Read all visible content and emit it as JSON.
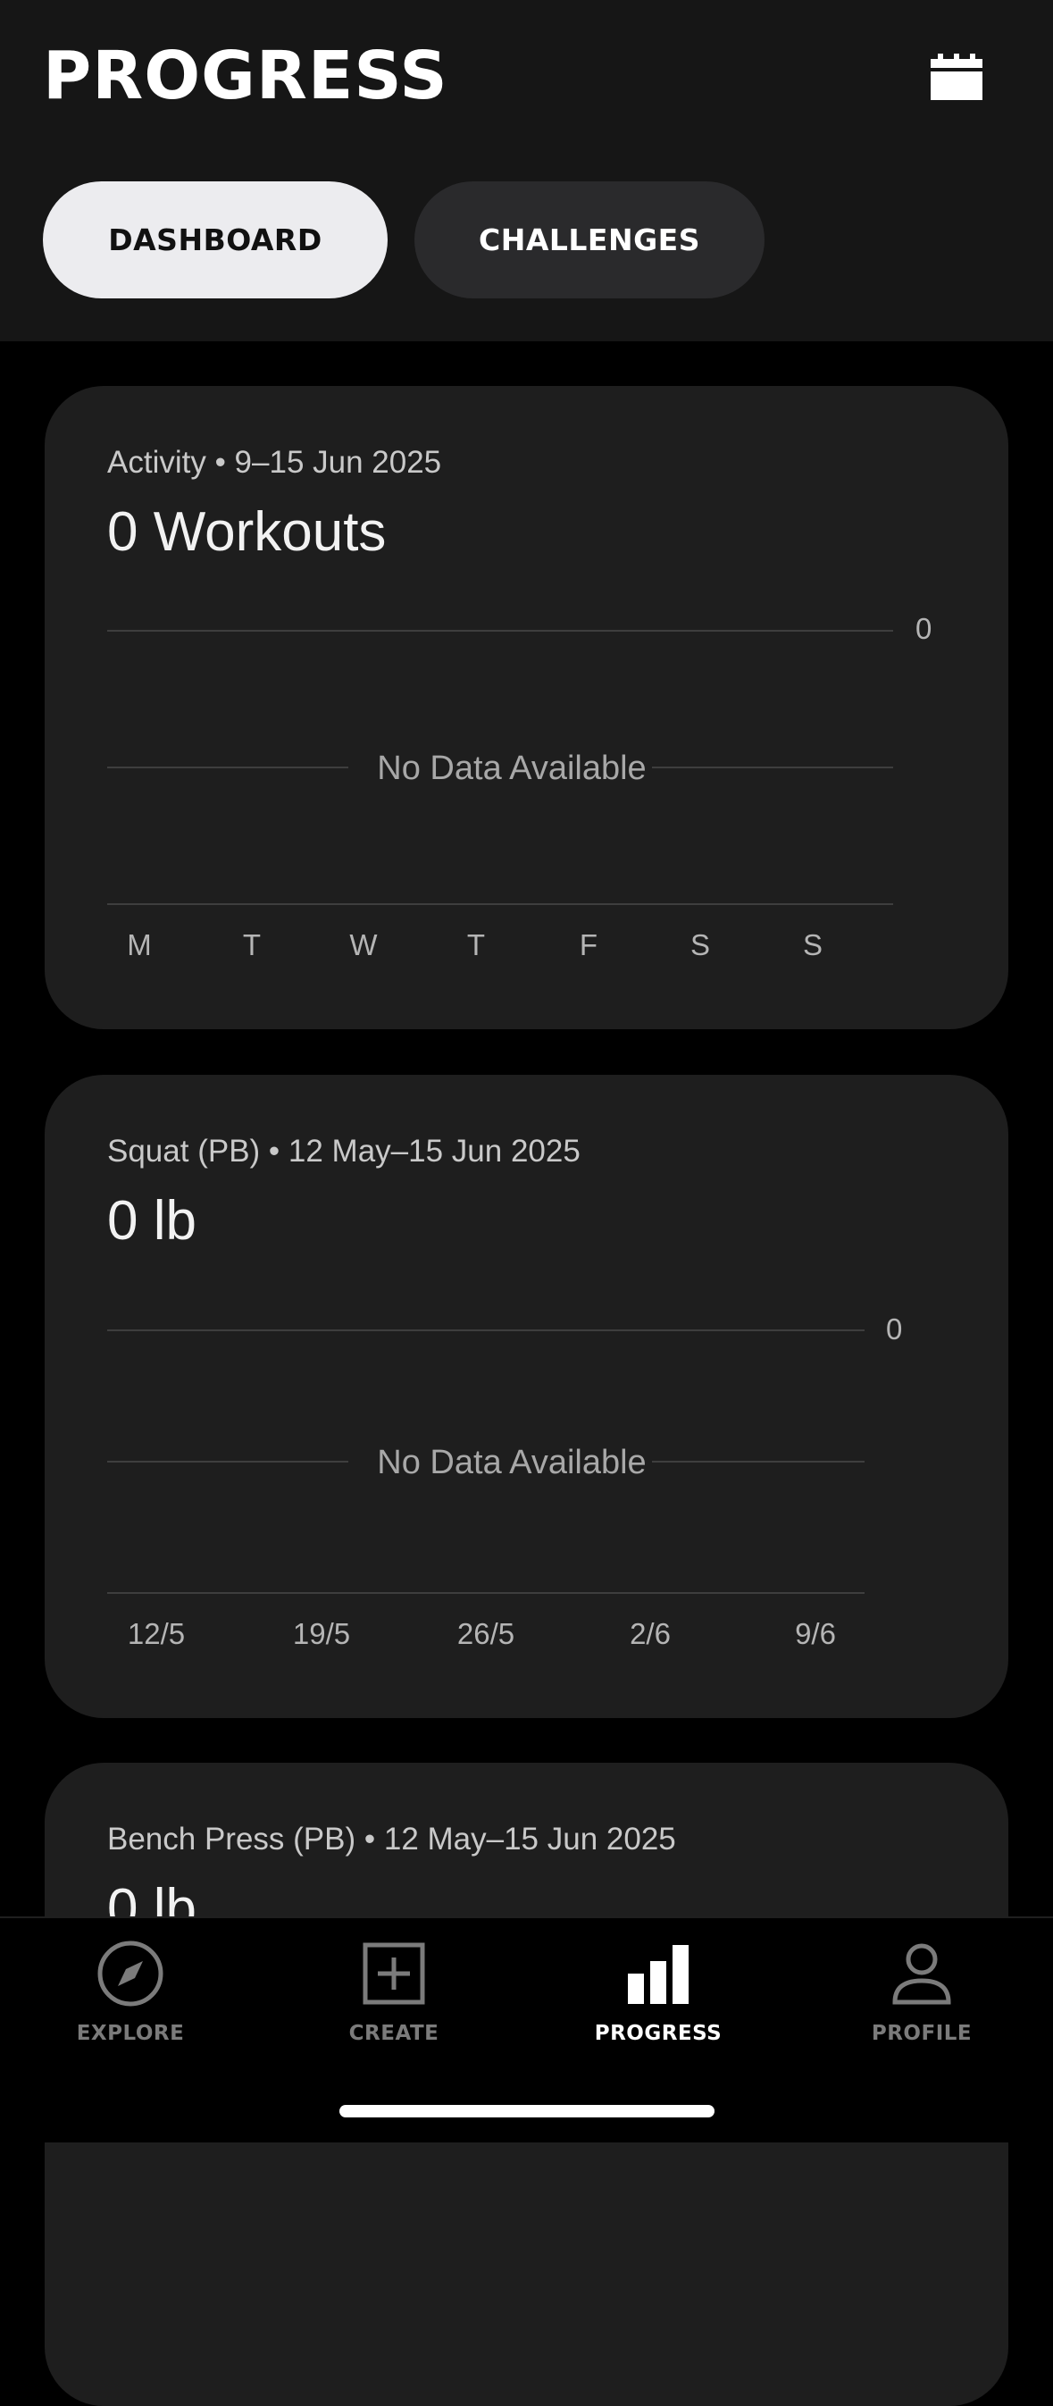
{
  "header": {
    "title": "PROGRESS",
    "calendar_icon": "calendar-icon",
    "segments": [
      {
        "label": "DASHBOARD",
        "active": true
      },
      {
        "label": "CHALLENGES",
        "active": false
      }
    ]
  },
  "cards": [
    {
      "label": "Activity • 9–15 Jun 2025",
      "value": "0 Workouts",
      "empty_text": "No Data Available",
      "y_tick": "0",
      "x_ticks": [
        "M",
        "T",
        "W",
        "T",
        "F",
        "S",
        "S"
      ]
    },
    {
      "label": "Squat (PB) • 12 May–15 Jun 2025",
      "value": "0 lb",
      "empty_text": "No Data Available",
      "y_tick": "0",
      "x_ticks": [
        "12/5",
        "19/5",
        "26/5",
        "2/6",
        "9/6"
      ]
    },
    {
      "label": "Bench Press (PB) • 12 May–15 Jun 2025",
      "value": "0 lb"
    }
  ],
  "tabbar": {
    "items": [
      {
        "label": "EXPLORE",
        "icon": "compass-icon",
        "active": false
      },
      {
        "label": "CREATE",
        "icon": "plus-square-icon",
        "active": false
      },
      {
        "label": "PROGRESS",
        "icon": "bar-chart-icon",
        "active": true
      },
      {
        "label": "PROFILE",
        "icon": "person-icon",
        "active": false
      }
    ]
  },
  "colors": {
    "background": "#000000",
    "header": "#161616",
    "card": "#1e1e1e",
    "active_segment": "#ececef",
    "inactive_segment": "#2a2a2c",
    "muted_text": "#7b7b7b"
  }
}
